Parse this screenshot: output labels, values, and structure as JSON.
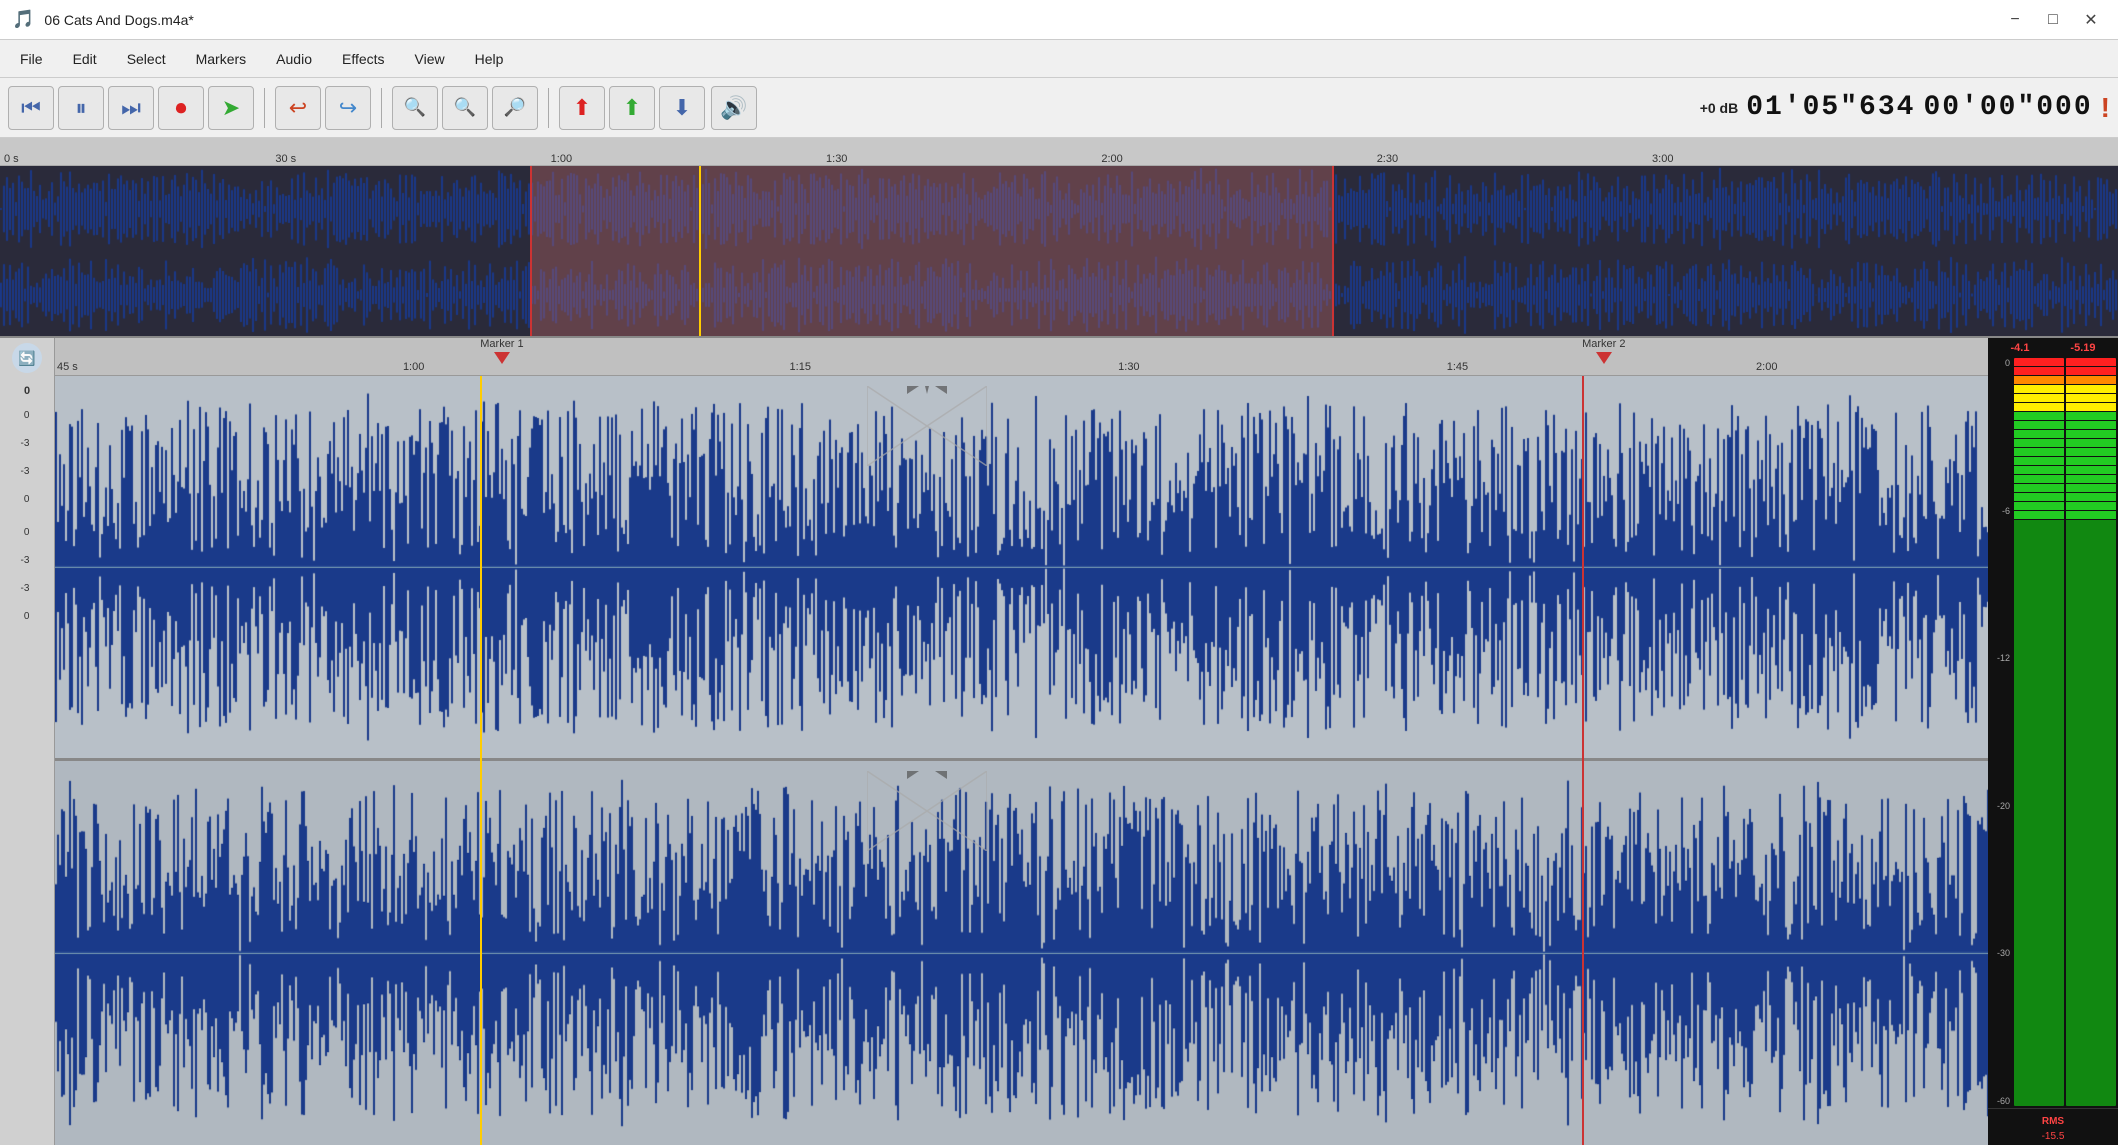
{
  "window": {
    "title": "06 Cats And Dogs.m4a*",
    "controls": {
      "minimize": "−",
      "maximize": "□",
      "close": "✕"
    }
  },
  "menu": {
    "items": [
      "File",
      "Edit",
      "Select",
      "Markers",
      "Audio",
      "Effects",
      "View",
      "Help"
    ]
  },
  "toolbar": {
    "transport": {
      "rewind": "⏮",
      "pause": "⏸",
      "forward": "⏭",
      "record": "⏺",
      "play_arrow": "➜"
    },
    "undo": "↩",
    "redo": "↪",
    "zoom_in": "🔍+",
    "zoom_out": "🔍−",
    "zoom_fit": "🔍",
    "db_value": "+0 dB",
    "time1": "01'05\"634",
    "time2": "00'00\"000"
  },
  "overview": {
    "ruler_marks": [
      "0 s",
      "30 s",
      "1:00",
      "1:30",
      "2:00",
      "2:30",
      "3:00"
    ]
  },
  "editor": {
    "ruler_marks": [
      "45 s",
      "1:00",
      "1:15",
      "1:30",
      "1:45",
      "2:00"
    ],
    "markers": [
      {
        "label": "Marker 1",
        "position_pct": 22
      },
      {
        "label": "Marker 2",
        "position_pct": 79
      }
    ],
    "db_labels_top": [
      "0",
      "-3",
      "-3",
      "0"
    ],
    "db_labels_bottom": [
      "0",
      "-3",
      "-3",
      "0"
    ],
    "playhead_pct_overview": 33,
    "playhead_pct_editor": 22,
    "selection_start_pct_overview": 25,
    "selection_end_pct_overview": 63
  },
  "vu_meter": {
    "peak_left": "-4.1",
    "peak_right": "-5.19",
    "scale_labels": [
      "0",
      "-6",
      "-12",
      "-20",
      "-30",
      "-60"
    ],
    "rms_label": "RMS",
    "rms_value": "-15.5"
  }
}
